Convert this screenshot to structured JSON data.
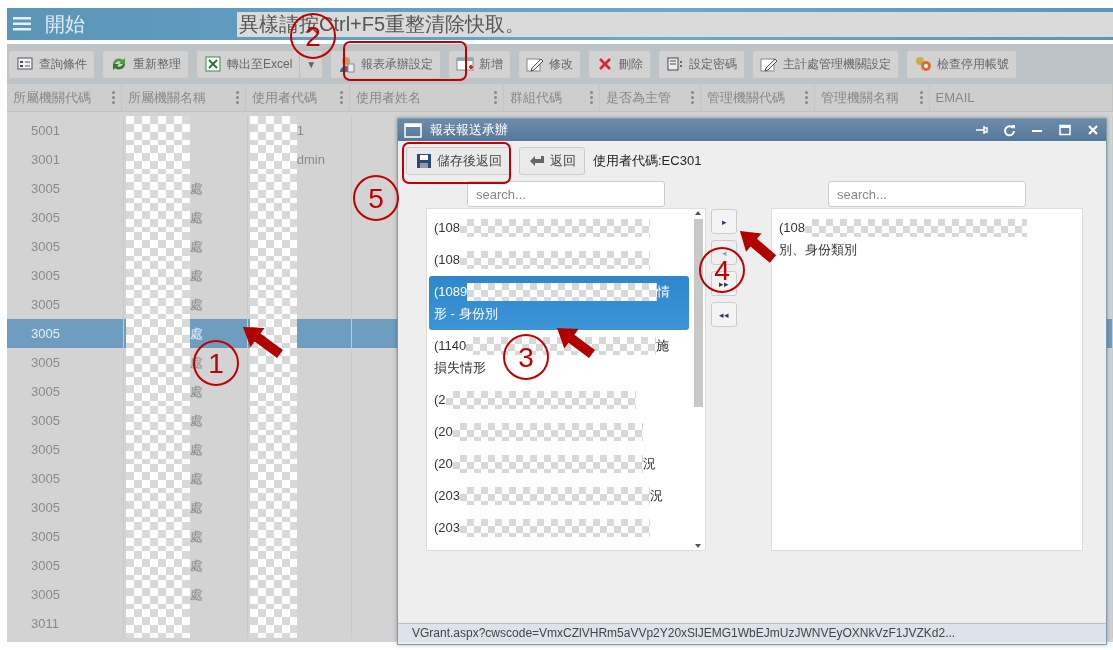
{
  "header": {
    "title": "開始",
    "notice": "異樣請按Ctrl+F5重整清除快取。"
  },
  "toolbar": [
    {
      "label": "查詢條件"
    },
    {
      "label": "重新整理"
    },
    {
      "label": "轉出至Excel",
      "dropdown": "▼"
    },
    {
      "label": "報表承辦設定"
    },
    {
      "label": "新增"
    },
    {
      "label": "修改"
    },
    {
      "label": "刪除"
    },
    {
      "label": "設定密碼"
    },
    {
      "label": "主計處管理機關設定"
    },
    {
      "label": "檢查停用帳號"
    }
  ],
  "grid": {
    "columns": [
      {
        "label": "所屬機關代碼"
      },
      {
        "label": "所屬機關名稱"
      },
      {
        "label": "使用者代碼"
      },
      {
        "label": "使用者姓名"
      },
      {
        "label": "群組代碼"
      },
      {
        "label": "是否為主管"
      },
      {
        "label": "管理機關代碼"
      },
      {
        "label": "管理機關名稱"
      },
      {
        "label": "EMAIL"
      }
    ],
    "rows": [
      {
        "cells": [
          "5001",
          "",
          "1"
        ],
        "selected": false
      },
      {
        "cells": [
          "3001",
          "",
          "dmin"
        ],
        "selected": false
      },
      {
        "cells": [
          "3005",
          "處",
          ""
        ],
        "selected": false
      },
      {
        "cells": [
          "3005",
          "處",
          ""
        ],
        "selected": false
      },
      {
        "cells": [
          "3005",
          "處",
          ""
        ],
        "selected": false
      },
      {
        "cells": [
          "3005",
          "處",
          ""
        ],
        "selected": false
      },
      {
        "cells": [
          "3005",
          "處",
          ""
        ],
        "selected": false
      },
      {
        "cells": [
          "3005",
          "處",
          ""
        ],
        "selected": true
      },
      {
        "cells": [
          "3005",
          "處",
          ""
        ],
        "selected": false
      },
      {
        "cells": [
          "3005",
          "處",
          ""
        ],
        "selected": false
      },
      {
        "cells": [
          "3005",
          "處",
          ""
        ],
        "selected": false
      },
      {
        "cells": [
          "3005",
          "處",
          ""
        ],
        "selected": false
      },
      {
        "cells": [
          "3005",
          "處",
          ""
        ],
        "selected": false
      },
      {
        "cells": [
          "3005",
          "處",
          ""
        ],
        "selected": false
      },
      {
        "cells": [
          "3005",
          "處",
          ""
        ],
        "selected": false
      },
      {
        "cells": [
          "3005",
          "處",
          ""
        ],
        "selected": false
      },
      {
        "cells": [
          "3005",
          "處",
          ""
        ],
        "selected": false
      },
      {
        "cells": [
          "3011",
          "",
          ""
        ],
        "selected": false
      }
    ]
  },
  "dialog": {
    "title": "報表報送承辦",
    "buttons": [
      {
        "label": "儲存後返回"
      },
      {
        "label": "返回"
      }
    ],
    "user_code": "使用者代碼:EC301",
    "left_search": {
      "placeholder": "search..."
    },
    "right_search": {
      "placeholder": "search..."
    },
    "available": [
      {
        "text": "(108",
        "selected": false
      },
      {
        "text": "(108",
        "selected": false
      },
      {
        "text": "(1089",
        "end": "情",
        "line2": "形 - 身份別",
        "selected": true
      },
      {
        "text": "(1140",
        "end": "施",
        "line2": "損失情形",
        "selected": false
      },
      {
        "text": "(2",
        "selected": false
      },
      {
        "text": "(20",
        "selected": false
      },
      {
        "text": "(20",
        "end": "況",
        "selected": false
      },
      {
        "text": "(203",
        "end": "況",
        "selected": false
      },
      {
        "text": "(203",
        "selected": false
      }
    ],
    "move_buttons": [
      {
        "label": "▸",
        "disabled": false
      },
      {
        "label": "◂",
        "disabled": true
      },
      {
        "label": "▸▸",
        "disabled": false
      },
      {
        "label": "◂◂",
        "disabled": false
      }
    ],
    "assigned": [
      {
        "text": "(108",
        "line2": "別、身份類別",
        "selected": false
      }
    ],
    "status": "VGrant.aspx?cwscode=VmxCZlVHRm5aVVp2Y20xSlJEMG1WbEJmUzJWNVEyOXNkVzF1JVZKd2..."
  },
  "annotations": [
    {
      "label": "1"
    },
    {
      "label": "2"
    },
    {
      "label": "3"
    },
    {
      "label": "4"
    },
    {
      "label": "5"
    }
  ]
}
